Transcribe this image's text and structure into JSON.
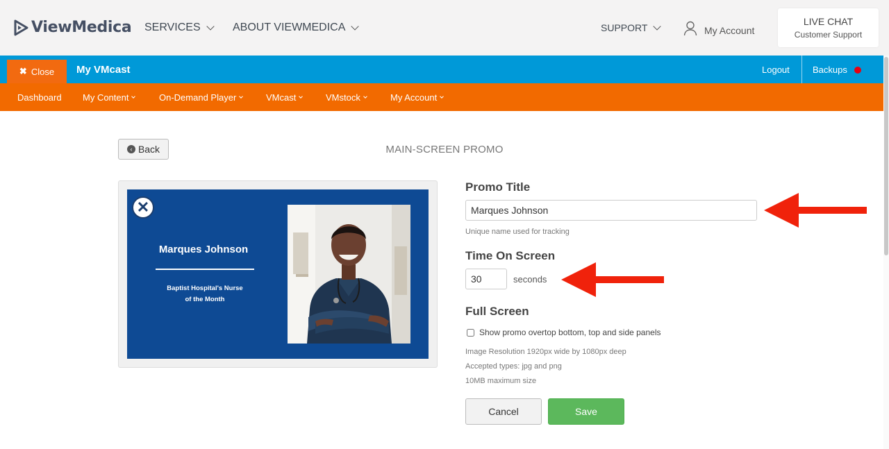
{
  "site_header": {
    "brand": "ViewMedica",
    "nav": [
      {
        "label": "SERVICES"
      },
      {
        "label": "ABOUT VIEWMEDICA"
      }
    ],
    "support_label": "SUPPORT",
    "account_label": "My Account",
    "live_chat": {
      "title": "LIVE CHAT",
      "subtitle": "Customer Support"
    }
  },
  "app_bar": {
    "close_label": "Close",
    "title": "My VMcast",
    "logout_label": "Logout",
    "backups_label": "Backups",
    "backups_status_color": "#e60012"
  },
  "menu": {
    "items": [
      {
        "label": "Dashboard"
      },
      {
        "label": "My Content"
      },
      {
        "label": "On-Demand Player"
      },
      {
        "label": "VMcast"
      },
      {
        "label": "VMstock"
      },
      {
        "label": "My Account"
      }
    ]
  },
  "page": {
    "back_label": "Back",
    "heading": "MAIN-SCREEN PROMO"
  },
  "preview": {
    "name": "Marques Johnson",
    "subtitle_line1": "Baptist Hospital's Nurse",
    "subtitle_line2": "of the Month",
    "background_color": "#0e4a94"
  },
  "form": {
    "promo_title_label": "Promo Title",
    "promo_title_value": "Marques Johnson",
    "promo_title_help": "Unique name used for tracking",
    "time_label": "Time On Screen",
    "time_value": "30",
    "time_unit": "seconds",
    "fullscreen_label": "Full Screen",
    "fullscreen_checkbox_label": "Show promo overtop bottom, top and side panels",
    "info_resolution": "Image Resolution 1920px wide by 1080px deep",
    "info_types": "Accepted types: jpg and png",
    "info_size": "10MB maximum size",
    "cancel_label": "Cancel",
    "save_label": "Save"
  },
  "colors": {
    "app_bar_blue": "#0099d8",
    "menu_orange": "#f26a00",
    "save_green": "#5cb85c",
    "annotation_arrow": "#f0220b"
  }
}
